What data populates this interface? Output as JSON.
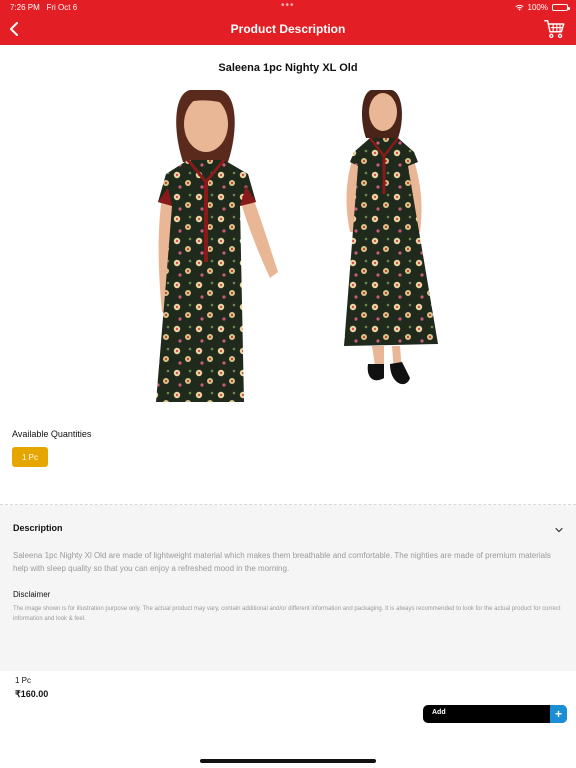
{
  "status_bar": {
    "time": "7:26 PM",
    "date": "Fri Oct 6",
    "battery": "100%",
    "dots": "•••"
  },
  "header": {
    "title": "Product Description",
    "back_icon": "chevron-left-icon",
    "cart_icon": "cart-icon",
    "color": "#e31e24"
  },
  "product": {
    "name": "Saleena 1pc Nighty XL Old",
    "image_icon": "product-photo"
  },
  "quantities": {
    "label": "Available Quantities",
    "options": [
      "1 Pc"
    ],
    "selected_color": "#e6a600"
  },
  "description": {
    "heading": "Description",
    "text": "Saleena 1pc Nighty Xl Old are made of lightweight material which makes them breathable and comfortable. The nighties are made of premium materials help with sleep quality so that you can enjoy a refreshed mood in the morning.",
    "disclaimer_heading": "Disclaimer",
    "disclaimer_text": "The image shown is for illustration purpose only. The actual product may vary, contain additional and/or different information and packaging. It is always recommended to look for the actual product for correct information and look & feel."
  },
  "footer": {
    "quantity": "1 Pc",
    "price": "₹160.00",
    "add_label": "Add",
    "plus": "+",
    "plus_color": "#1a8fd6"
  }
}
